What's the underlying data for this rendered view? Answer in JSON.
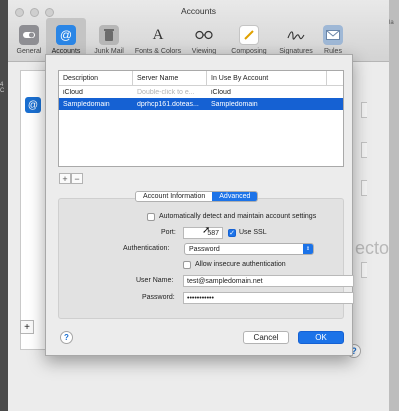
{
  "window": {
    "title": "Accounts"
  },
  "toolbar": {
    "items": [
      {
        "label": "General",
        "icon": "switch-icon",
        "selected": false
      },
      {
        "label": "Accounts",
        "icon": "at-sign-icon",
        "selected": true
      },
      {
        "label": "Junk Mail",
        "icon": "trash-icon",
        "selected": false
      },
      {
        "label": "Fonts & Colors",
        "icon": "font-icon",
        "selected": false
      },
      {
        "label": "Viewing",
        "icon": "glasses-icon",
        "selected": false
      },
      {
        "label": "Composing",
        "icon": "pencil-icon",
        "selected": false
      },
      {
        "label": "Signatures",
        "icon": "signature-icon",
        "selected": false
      },
      {
        "label": "Rules",
        "icon": "envelope-icon",
        "selected": false
      }
    ]
  },
  "accounts_table": {
    "columns": [
      "Description",
      "Server Name",
      "In Use By Account"
    ],
    "rows": [
      {
        "description": "iCloud",
        "server": "Double-click to e...",
        "in_use": "iCloud",
        "selected": false
      },
      {
        "description": "Sampledomain",
        "server": "dprhcp161.doteas...",
        "in_use": "Sampledomain",
        "selected": true
      }
    ]
  },
  "table_controls": {
    "add": "+",
    "remove": "−"
  },
  "tabs": {
    "account_information": "Account Information",
    "advanced": "Advanced",
    "active": "Advanced"
  },
  "advanced": {
    "auto_detect_label": "Automatically detect and maintain account settings",
    "auto_detect_checked": false,
    "port_label": "Port:",
    "port_value": "587",
    "use_ssl_label": "Use SSL",
    "use_ssl_checked": true,
    "authentication_label": "Authentication:",
    "authentication_value": "Password",
    "allow_insecure_label": "Allow insecure authentication",
    "allow_insecure_checked": false,
    "username_label": "User Name:",
    "username_value": "test@sampledomain.net",
    "password_label": "Password:",
    "password_value": "•••••••••••"
  },
  "buttons": {
    "cancel": "Cancel",
    "ok": "OK",
    "help": "?"
  },
  "background": {
    "right_fragment": "ecto",
    "left_fragment": "4 C",
    "right_hint": "la"
  },
  "colors": {
    "accent": "#1c73e8",
    "selection": "#1561d3"
  }
}
